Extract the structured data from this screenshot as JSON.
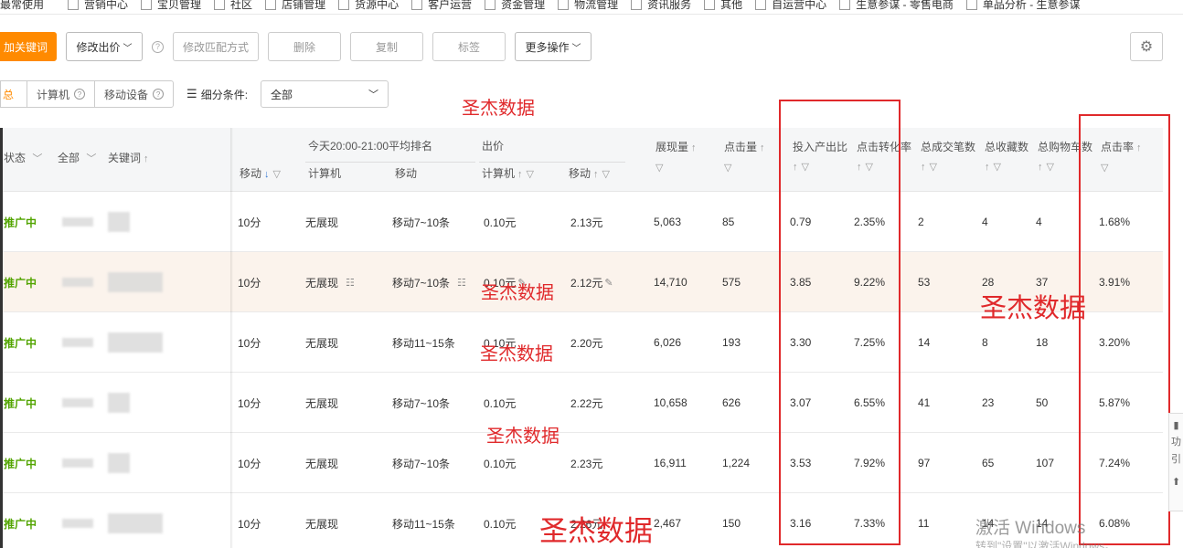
{
  "categories": {
    "first": "最常使用",
    "items": [
      "营销中心",
      "宝贝管理",
      "社区",
      "店铺管理",
      "货源中心",
      "客户运营",
      "资金管理",
      "物流管理",
      "资讯服务",
      "其他",
      "自运营中心",
      "生意参谋 - 零售电商",
      "单品分析 - 生意参谋"
    ]
  },
  "toolbar": {
    "add_keyword": "加关键词",
    "modify_bid": "修改出价",
    "modify_match": "修改匹配方式",
    "delete": "删除",
    "copy": "复制",
    "tag": "标签",
    "more": "更多操作"
  },
  "filter": {
    "summary": "总",
    "computer": "计算机",
    "mobile": "移动设备",
    "subcondition_label": "细分条件:",
    "select_value": "全部"
  },
  "table": {
    "headers": {
      "status": "状态",
      "all": "全部",
      "keyword": "关键词",
      "mobile_score": "移动",
      "rank_group": "今天20:00-21:00平均排名",
      "rank_pc": "计算机",
      "rank_mobile": "移动",
      "bid_group": "出价",
      "bid_pc": "计算机",
      "bid_mobile": "移动",
      "impressions": "展现量",
      "clicks": "点击量",
      "roi": "投入产出比",
      "cvr": "点击转化率",
      "orders": "总成交笔数",
      "favorites": "总收藏数",
      "carts": "总购物车数",
      "ctr": "点击率"
    },
    "rows": [
      {
        "status": "推广中",
        "score": "10分",
        "rank_pc": "无展现",
        "rank_mobile": "移动7~10条",
        "bid_pc": "0.10元",
        "bid_mobile": "2.13元",
        "impressions": "5,063",
        "clicks": "85",
        "roi": "0.79",
        "cvr": "2.35%",
        "orders": "2",
        "favorites": "4",
        "carts": "4",
        "ctr": "1.68%"
      },
      {
        "status": "推广中",
        "score": "10分",
        "rank_pc": "无展现",
        "rank_mobile": "移动7~10条",
        "bid_pc": "0.10元",
        "bid_mobile": "2.12元",
        "impressions": "14,710",
        "clicks": "575",
        "roi": "3.85",
        "cvr": "9.22%",
        "orders": "53",
        "favorites": "28",
        "carts": "37",
        "ctr": "3.91%"
      },
      {
        "status": "推广中",
        "score": "10分",
        "rank_pc": "无展现",
        "rank_mobile": "移动11~15条",
        "bid_pc": "0.10元",
        "bid_mobile": "2.20元",
        "impressions": "6,026",
        "clicks": "193",
        "roi": "3.30",
        "cvr": "7.25%",
        "orders": "14",
        "favorites": "8",
        "carts": "18",
        "ctr": "3.20%"
      },
      {
        "status": "推广中",
        "score": "10分",
        "rank_pc": "无展现",
        "rank_mobile": "移动7~10条",
        "bid_pc": "0.10元",
        "bid_mobile": "2.22元",
        "impressions": "10,658",
        "clicks": "626",
        "roi": "3.07",
        "cvr": "6.55%",
        "orders": "41",
        "favorites": "23",
        "carts": "50",
        "ctr": "5.87%"
      },
      {
        "status": "推广中",
        "score": "10分",
        "rank_pc": "无展现",
        "rank_mobile": "移动7~10条",
        "bid_pc": "0.10元",
        "bid_mobile": "2.23元",
        "impressions": "16,911",
        "clicks": "1,224",
        "roi": "3.53",
        "cvr": "7.92%",
        "orders": "97",
        "favorites": "65",
        "carts": "107",
        "ctr": "7.24%"
      },
      {
        "status": "推广中",
        "score": "10分",
        "rank_pc": "无展现",
        "rank_mobile": "移动11~15条",
        "bid_pc": "0.10元",
        "bid_mobile": "2.26元",
        "impressions": "2,467",
        "clicks": "150",
        "roi": "3.16",
        "cvr": "7.33%",
        "orders": "11",
        "favorites": "14",
        "carts": "14",
        "ctr": "6.08%"
      }
    ]
  },
  "watermarks": {
    "main": "圣杰数据",
    "windows_title": "激活 Windows",
    "windows_sub": "转到\"设置\"以激活Windows。"
  },
  "side_panel": {
    "line1": "功",
    "line2": "引"
  },
  "colors": {
    "accent": "#ff8a00",
    "status_green": "#52a400",
    "highlight_box": "#e0292b"
  }
}
